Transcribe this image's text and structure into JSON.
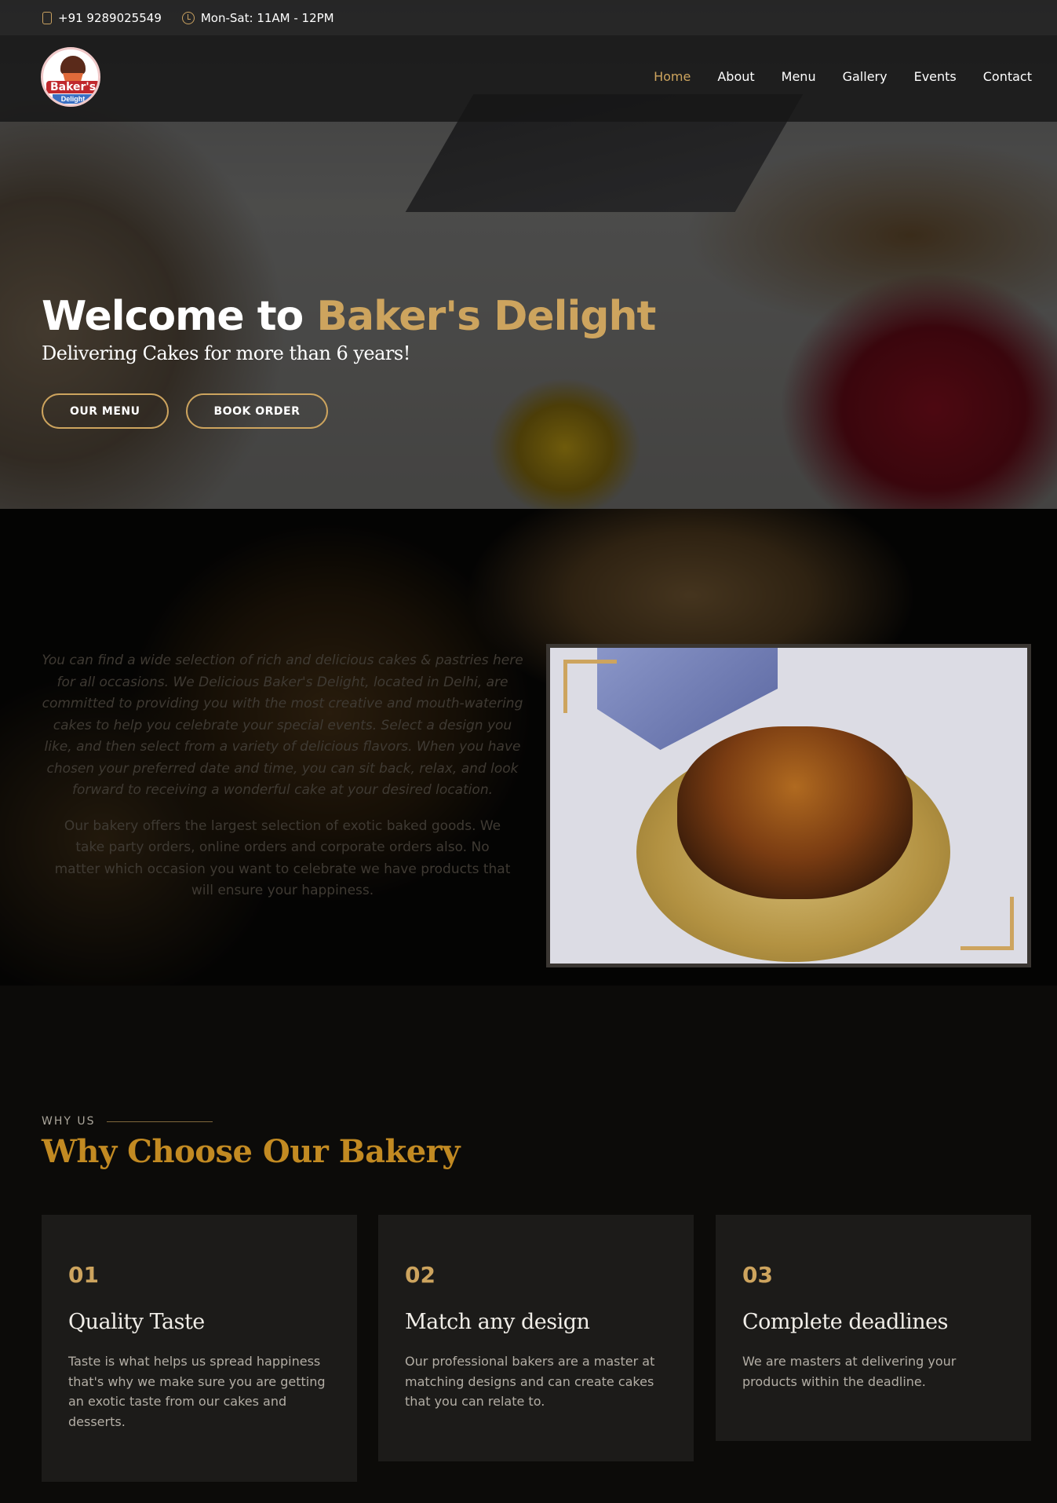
{
  "topbar": {
    "phone": "+91 9289025549",
    "hours": "Mon-Sat: 11AM - 12PM"
  },
  "header": {
    "logo": {
      "name": "Baker's",
      "sub": "Delight"
    },
    "nav": [
      "Home",
      "About",
      "Menu",
      "Gallery",
      "Events",
      "Contact"
    ],
    "active": "Home"
  },
  "hero": {
    "title_prefix": "Welcome to ",
    "title_brand": "Baker's Delight",
    "subtitle": "Delivering Cakes for more than 6 years!",
    "btn_menu": "OUR MENU",
    "btn_order": "BOOK ORDER"
  },
  "about": {
    "p1": "You can find a wide selection of rich and delicious cakes & pastries here for all occasions. We Delicious Baker's Delight, located in Delhi, are committed to providing you with the most creative and mouth-watering cakes to help you celebrate your special events. Select a design you like, and then select from a variety of delicious flavors. When you have chosen your preferred date and time, you can sit back, relax, and look forward to receiving a wonderful cake at your desired location.",
    "p2": "Our bakery offers the largest selection of exotic baked goods. We take party orders, online orders and corporate orders also. No matter which occasion you want to celebrate we have products that will ensure your happiness."
  },
  "why": {
    "label": "WHY US",
    "title": "Why Choose Our Bakery",
    "cards": [
      {
        "num": "01",
        "title": "Quality Taste",
        "desc": "Taste is what helps us spread happiness that's why we make sure you are getting an exotic taste from our cakes and desserts."
      },
      {
        "num": "02",
        "title": "Match any design",
        "desc": "Our professional bakers are a master at matching designs and can create cakes that you can relate to."
      },
      {
        "num": "03",
        "title": "Complete deadlines",
        "desc": "We are masters at delivering your products within the deadline."
      }
    ]
  },
  "colors": {
    "accent": "#cda45e",
    "title_gold": "#c28a22",
    "card_bg": "#1c1b19"
  }
}
